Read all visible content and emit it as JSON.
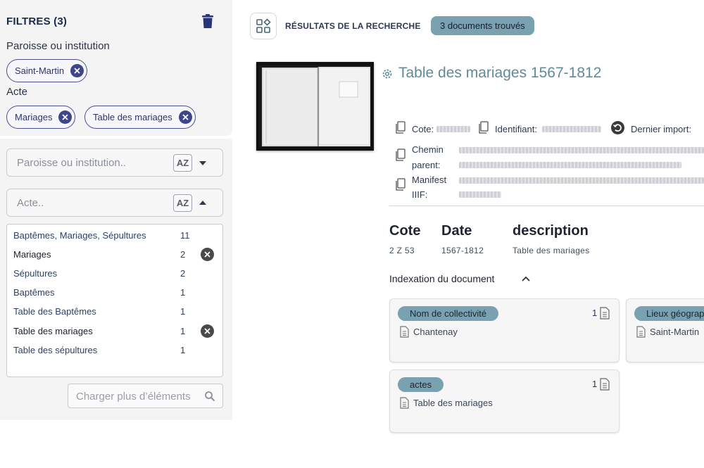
{
  "filters": {
    "title": "FILTRES (3)",
    "groups": [
      {
        "label": "Paroisse ou institution",
        "chips": [
          "Saint-Martin"
        ]
      },
      {
        "label": "Acte",
        "chips": [
          "Mariages",
          "Table des mariages"
        ]
      }
    ]
  },
  "search": {
    "parish_placeholder": "Paroisse ou institution..",
    "acte_placeholder": "Acte..",
    "az_label": "AZ",
    "facets": [
      {
        "label": "Baptêmes, Mariages, Sépultures",
        "count": "11",
        "selected": false
      },
      {
        "label": "Mariages",
        "count": "2",
        "selected": true
      },
      {
        "label": "Sépultures",
        "count": "2",
        "selected": false
      },
      {
        "label": "Baptêmes",
        "count": "1",
        "selected": false
      },
      {
        "label": "Table des Baptêmes",
        "count": "1",
        "selected": false
      },
      {
        "label": "Table des mariages",
        "count": "1",
        "selected": true
      },
      {
        "label": "Table des sépultures",
        "count": "1",
        "selected": false
      }
    ],
    "load_more": "Charger plus d’éléments"
  },
  "results": {
    "title": "RÉSULTATS DE LA RECHERCHE",
    "badge": "3 documents trouvés"
  },
  "document": {
    "title": "Table des mariages 1567-1812",
    "meta": {
      "cote_label": "Cote:",
      "identifiant_label": "Identifiant:",
      "import_label": "Dernier import:",
      "chemin_label_1": "Chemin",
      "chemin_label_2": "parent:",
      "manifest_label_1": "Manifest",
      "manifest_label_2": "IIIF:"
    },
    "columns": [
      {
        "head": "Cote",
        "value": "2 Z 53"
      },
      {
        "head": "Date",
        "value": "1567-1812"
      },
      {
        "head": "description",
        "value": "Table des mariages"
      }
    ],
    "indexation_title": "Indexation du document",
    "cards": [
      {
        "tag": "Nom de collectivité",
        "count": "1",
        "item": "Chantenay"
      },
      {
        "tag": "Lieux géograp",
        "count": "",
        "item": "Saint-Martin"
      },
      {
        "tag": "actes",
        "count": "1",
        "item": "Table des mariages"
      }
    ]
  },
  "colors": {
    "accent": "#79a1af",
    "chip_border": "#4a4e8a",
    "title": "#5e8b99"
  }
}
